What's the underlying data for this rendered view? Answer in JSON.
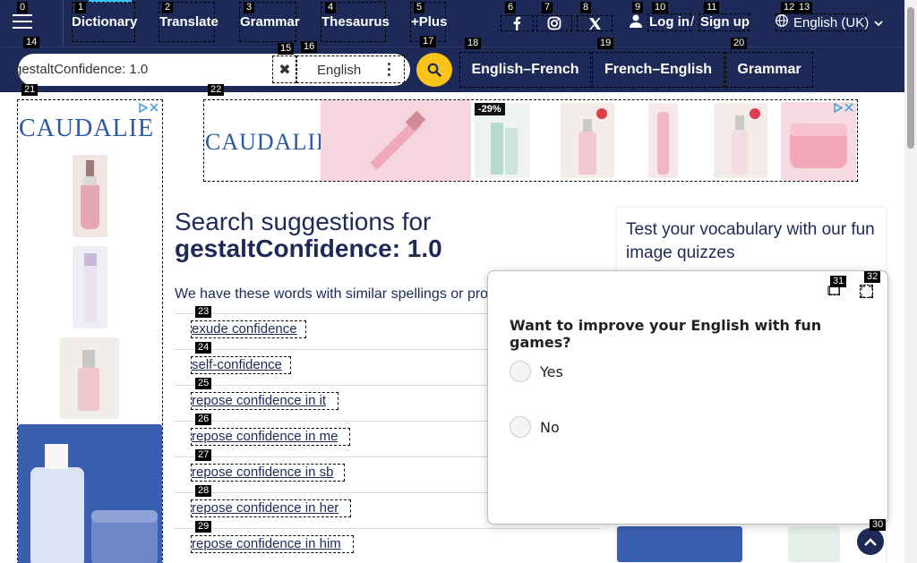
{
  "nav": {
    "items": [
      {
        "label": "Dictionary"
      },
      {
        "label": "Translate"
      },
      {
        "label": "Grammar"
      },
      {
        "label": "Thesaurus"
      },
      {
        "label": "+Plus"
      }
    ],
    "social": [
      "facebook-icon",
      "instagram-icon",
      "x-icon"
    ],
    "login": "Log in",
    "slash": "/",
    "signup": "Sign up",
    "language": "English (UK)"
  },
  "search": {
    "value": "gestaltConfidence: 1.0",
    "language": "English",
    "tabs": [
      {
        "label": "English–French"
      },
      {
        "label": "French–English"
      },
      {
        "label": "Grammar"
      }
    ]
  },
  "ads": {
    "brand": "CAUDALIE",
    "discount": "-29%",
    "colors": {
      "brand": "#2c5aa0",
      "pink": "#f6d5de",
      "blue": "#3b5fb0"
    }
  },
  "main": {
    "title_prefix": "Search suggestions for",
    "title_query": "gestaltConfidence: 1.0",
    "intro": "We have these words with similar spellings or pronunciations:",
    "suggestions": [
      "exude confidence",
      "self-confidence",
      "repose confidence in it",
      "repose confidence in me",
      "repose confidence in sb",
      "repose confidence in her",
      "repose confidence in him"
    ]
  },
  "sidebar": {
    "quiz_title": "Test your vocabulary with our fun image quizzes"
  },
  "popup": {
    "question": "Want to improve your English with fun games?",
    "options": [
      "Yes",
      "No"
    ]
  },
  "badges": [
    "0",
    "1",
    "2",
    "3",
    "4",
    "5",
    "6",
    "7",
    "8",
    "9",
    "10",
    "11",
    "12",
    "13",
    "14",
    "15",
    "16",
    "17",
    "18",
    "19",
    "20",
    "21",
    "22",
    "23",
    "24",
    "25",
    "26",
    "27",
    "28",
    "29",
    "30",
    "31",
    "32"
  ],
  "theme": {
    "nav_bg": "#1d2a57",
    "accent": "#fcc419",
    "active": "#39c3ff"
  }
}
